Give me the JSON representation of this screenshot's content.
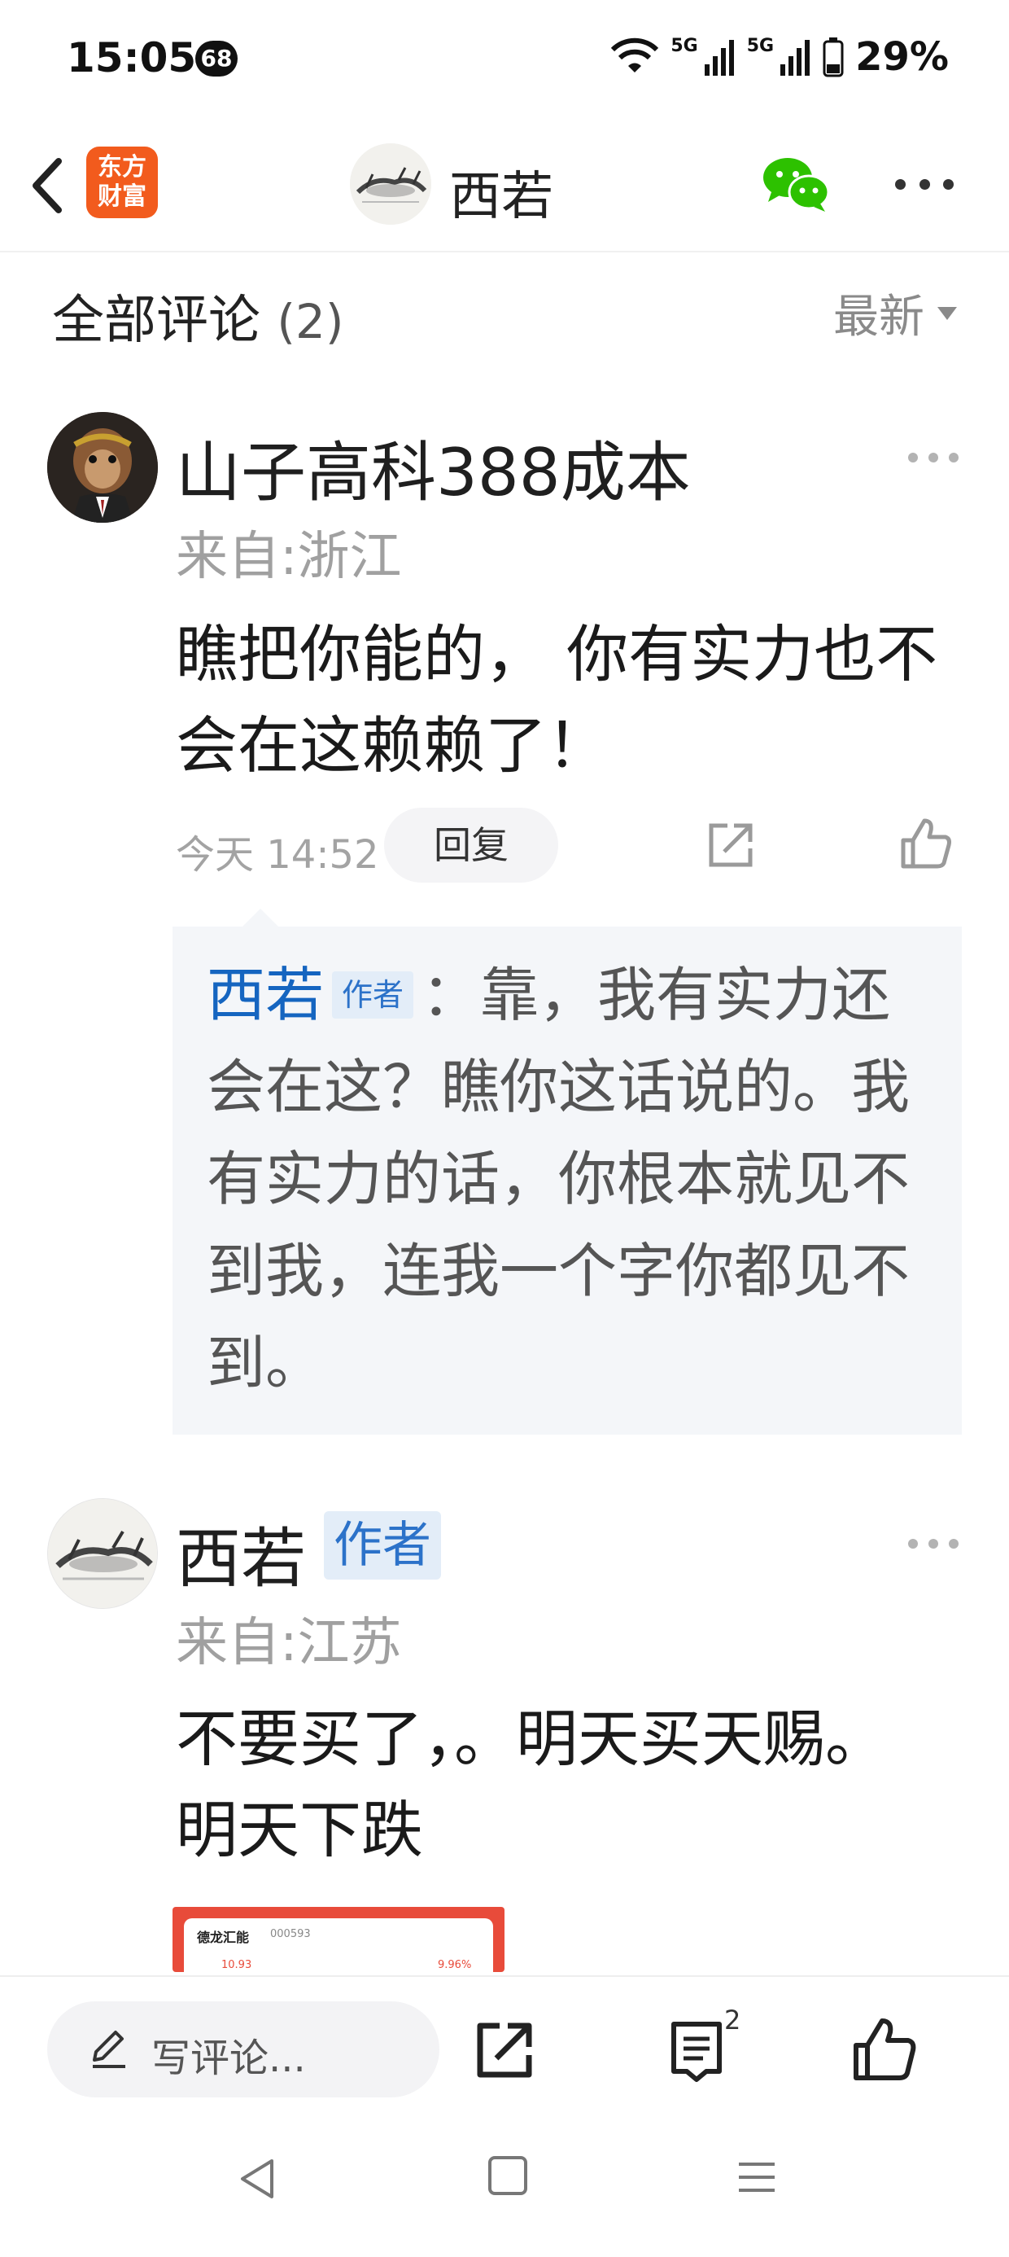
{
  "status_bar": {
    "time": "15:05",
    "notification_count": "68",
    "network_1": "5G",
    "network_2": "5G",
    "battery": "29%"
  },
  "nav": {
    "app_logo_text": "东方财富",
    "title": "西若"
  },
  "comments_header": {
    "label": "全部评论",
    "count": "(2)",
    "sort": "最新"
  },
  "comments": [
    {
      "username": "山子高科388成本",
      "location": "来自:浙江",
      "text": "瞧把你能的， 你有实力也不会在这赖赖了！",
      "time": "今天 14:52",
      "reply_label": "回复",
      "replies": [
        {
          "author": "西若",
          "author_tag": "作者",
          "text": "：靠，我有实力还会在这？瞧你这话说的。我有实力的话，你根本就见不到我，连我一个字你都见不到。"
        }
      ]
    },
    {
      "username": "西若",
      "author_tag": "作者",
      "location": "来自:江苏",
      "text": "不要买了，。明天买天赐。明天下跌",
      "image": {
        "stock_name": "德龙汇能",
        "stock_code": "000593",
        "value_left": "10.93",
        "value_right": "9.96%"
      }
    }
  ],
  "toolbar": {
    "compose_placeholder": "写评论...",
    "comment_count": "2"
  },
  "colors": {
    "brand": "#f25b1d",
    "author_blue": "#1565c0",
    "wechat_green": "#2dc100"
  }
}
